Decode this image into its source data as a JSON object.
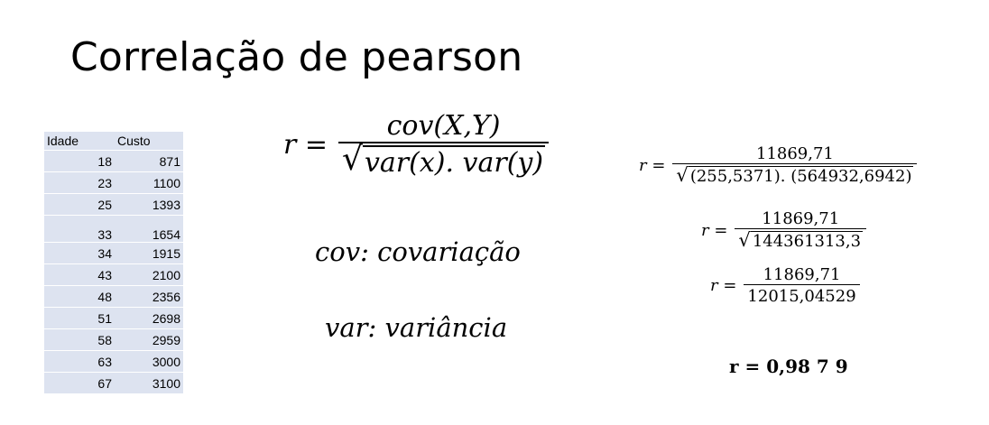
{
  "title": "Correlação de pearson",
  "table": {
    "headers": [
      "Idade",
      "Custo"
    ],
    "rows": [
      [
        "18",
        "871"
      ],
      [
        "23",
        "1100"
      ],
      [
        "25",
        "1393"
      ],
      [
        "33",
        "1654"
      ],
      [
        "34",
        "1915"
      ],
      [
        "43",
        "2100"
      ],
      [
        "48",
        "2356"
      ],
      [
        "51",
        "2698"
      ],
      [
        "58",
        "2959"
      ],
      [
        "63",
        "3000"
      ],
      [
        "67",
        "3100"
      ]
    ]
  },
  "formula": {
    "lhs": "r =",
    "numerator": "cov(X,Y)",
    "denominator": "var(x). var(y)"
  },
  "definitions": {
    "cov": "cov: covariação",
    "var": "var: variância"
  },
  "calculation": {
    "lhs": "r =",
    "step1_num": "11869,71",
    "step1_den": "(255,5371). (564932,6942)",
    "step2_num": "11869,71",
    "step2_den": "144361313,3",
    "step3_num": "11869,71",
    "step3_den": "12015,04529",
    "result": "r = 0,98 7 9"
  }
}
